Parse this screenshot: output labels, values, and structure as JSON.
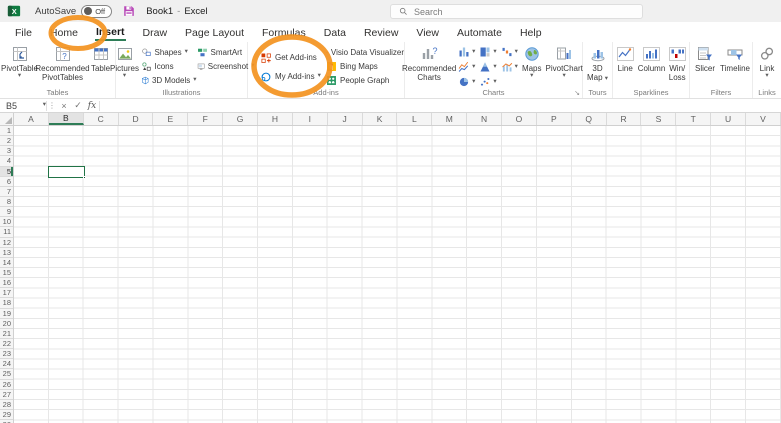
{
  "titlebar": {
    "autosave_label": "AutoSave",
    "autosave_state": "Off",
    "doc_title": "Book1",
    "title_separator": "-",
    "app_name": "Excel",
    "search_placeholder": "Search"
  },
  "tabs": [
    "File",
    "Home",
    "Insert",
    "Draw",
    "Page Layout",
    "Formulas",
    "Data",
    "Review",
    "View",
    "Automate",
    "Help"
  ],
  "active_tab": "Insert",
  "ribbon": {
    "tables": {
      "label": "Tables",
      "pivottable": "PivotTable",
      "recommended_pivottables": "Recommended PivotTables",
      "table": "Table"
    },
    "illustrations": {
      "label": "Illustrations",
      "pictures": "Pictures",
      "shapes": "Shapes",
      "icons": "Icons",
      "models_3d": "3D Models",
      "smartart": "SmartArt",
      "screenshot": "Screenshot"
    },
    "addins": {
      "label": "Add-ins",
      "get_addins": "Get Add-ins",
      "my_addins": "My Add-ins",
      "visio": "Visio Data Visualizer",
      "bing_maps": "Bing Maps",
      "people_graph": "People Graph"
    },
    "charts": {
      "label": "Charts",
      "recommended_charts": "Recommended Charts",
      "maps": "Maps",
      "pivotchart": "PivotChart"
    },
    "tours": {
      "label": "Tours",
      "map_3d_line1": "3D",
      "map_3d_line2": "Map"
    },
    "sparklines": {
      "label": "Sparklines",
      "line": "Line",
      "column": "Column",
      "winloss_line1": "Win/",
      "winloss_line2": "Loss"
    },
    "filters": {
      "label": "Filters",
      "slicer": "Slicer",
      "timeline": "Timeline"
    },
    "links": {
      "label": "Links",
      "link": "Link"
    }
  },
  "formula_bar": {
    "name_box": "B5",
    "formula_value": ""
  },
  "icons": {
    "caret": "▾",
    "dots": "⋮",
    "cancel": "×",
    "enter": "✓",
    "fx": "fx",
    "dialog_launcher": "↘"
  },
  "grid": {
    "columns": [
      "A",
      "B",
      "C",
      "D",
      "E",
      "F",
      "G",
      "H",
      "I",
      "J",
      "K",
      "L",
      "M",
      "N",
      "O",
      "P",
      "Q",
      "R",
      "S",
      "T",
      "U",
      "V"
    ],
    "row_count": 30,
    "selected_cell": "B5",
    "selected_column": "B",
    "selected_row": 5
  },
  "annotations": {
    "highlight_color": "#F39321",
    "items": [
      "insert-tab-circle",
      "addins-buttons-circle"
    ]
  }
}
